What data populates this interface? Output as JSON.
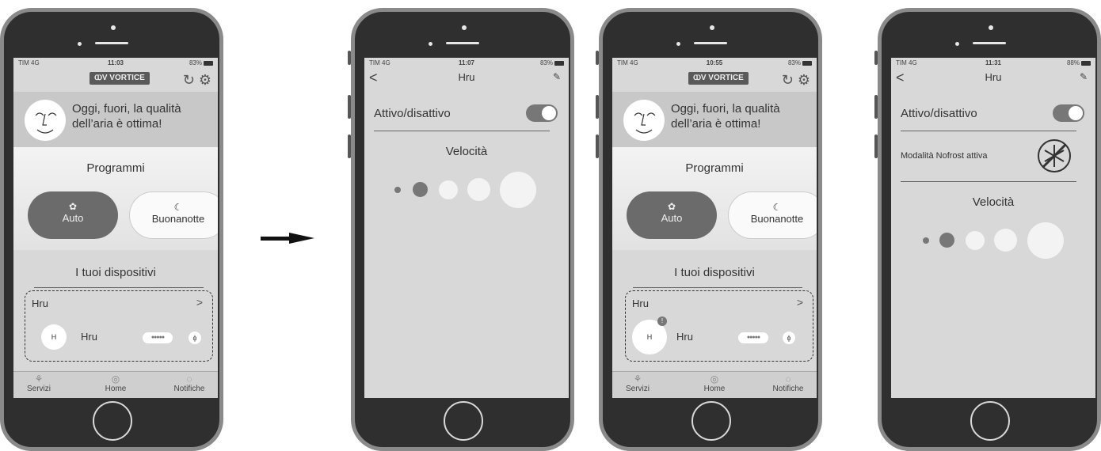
{
  "arrow": {
    "icon": "right-arrow-icon"
  },
  "phone1": {
    "status": {
      "carrier": "TIM  4G",
      "time": "11:03",
      "battery": "83%"
    },
    "logo": "ⲰV VORTICE",
    "air_quality": "Oggi, fuori, la qualità dell’aria è ottima!",
    "programs_title": "Programmi",
    "program_auto": "Auto",
    "program_night": "Buonanotte",
    "devices_title": "I tuoi dispositivi",
    "device_group": "Hru",
    "device_initial": "H",
    "device_name": "Hru",
    "tabs": [
      "Servizi",
      "Home",
      "Notifiche"
    ]
  },
  "phone2": {
    "status": {
      "carrier": "TIM  4G",
      "time": "11:07",
      "battery": "83%"
    },
    "title": "Hru",
    "toggle_label": "Attivo/disattivo",
    "toggle_on": true,
    "speed_title": "Velocità",
    "speed_level": 2
  },
  "phone3": {
    "status": {
      "carrier": "TIM  4G",
      "time": "10:55",
      "battery": "83%"
    },
    "logo": "ⲰV VORTICE",
    "air_quality": "Oggi, fuori, la qualità dell’aria è ottima!",
    "programs_title": "Programmi",
    "program_auto": "Auto",
    "program_night": "Buonanotte",
    "devices_title": "I tuoi dispositivi",
    "device_group": "Hru",
    "device_initial": "H",
    "device_name": "Hru",
    "tabs": [
      "Servizi",
      "Home",
      "Notifiche"
    ]
  },
  "phone4": {
    "status": {
      "carrier": "TIM  4G",
      "time": "11:31",
      "battery": "88%"
    },
    "title": "Hru",
    "toggle_label": "Attivo/disattivo",
    "toggle_on": true,
    "nofrost_label": "Modalità Nofrost attiva",
    "speed_title": "Velocità",
    "speed_level": 2
  }
}
